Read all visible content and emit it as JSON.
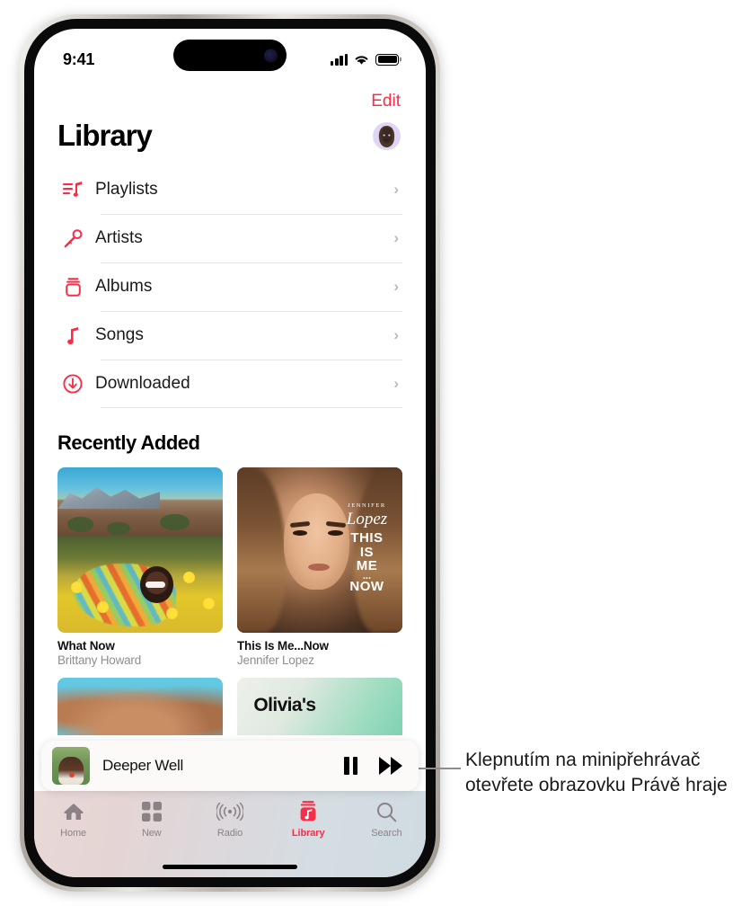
{
  "status_bar": {
    "time": "9:41",
    "signal_icon": "cellular-bars-icon",
    "wifi_icon": "wifi-icon",
    "battery_icon": "battery-full-icon"
  },
  "header": {
    "edit_label": "Edit",
    "title": "Library",
    "avatar_name": "memoji-avatar"
  },
  "library_list": [
    {
      "label": "Playlists",
      "icon": "playlists-icon",
      "chevron": "›"
    },
    {
      "label": "Artists",
      "icon": "microphone-icon",
      "chevron": "›"
    },
    {
      "label": "Albums",
      "icon": "albums-icon",
      "chevron": "›"
    },
    {
      "label": "Songs",
      "icon": "music-note-icon",
      "chevron": "›"
    },
    {
      "label": "Downloaded",
      "icon": "download-circle-icon",
      "chevron": "›"
    }
  ],
  "recently_added": {
    "section_title": "Recently Added",
    "albums": [
      {
        "title": "What Now",
        "artist": "Brittany Howard"
      },
      {
        "title": "This Is Me...Now",
        "artist": "Jennifer Lopez",
        "cover_text": {
          "name": "JENNIFER",
          "script": "Lopez",
          "line1": "THIS",
          "line2": "IS",
          "line3": "ME",
          "dots": "...",
          "line4": "NOW"
        }
      }
    ],
    "next_row": [
      {
        "cover_label": ""
      },
      {
        "cover_label": "Olivia's"
      }
    ]
  },
  "mini_player": {
    "track_title": "Deeper Well",
    "artwork_name": "deeper-well-artwork",
    "pause_icon": "pause-icon",
    "forward_icon": "fast-forward-icon"
  },
  "tab_bar": {
    "tabs": [
      {
        "label": "Home",
        "icon": "home-icon",
        "active": false
      },
      {
        "label": "New",
        "icon": "grid-icon",
        "active": false
      },
      {
        "label": "Radio",
        "icon": "radio-waves-icon",
        "active": false
      },
      {
        "label": "Library",
        "icon": "library-icon",
        "active": true
      },
      {
        "label": "Search",
        "icon": "search-icon",
        "active": false
      }
    ]
  },
  "callout": {
    "text": "Klepnutím na minipřehrávač otevřete obrazovku Právě hraje"
  },
  "colors": {
    "accent_red": "#fa2d48",
    "text_primary": "#1a1a1a",
    "text_secondary": "#8e8e93",
    "separator": "#e3e3e5"
  }
}
